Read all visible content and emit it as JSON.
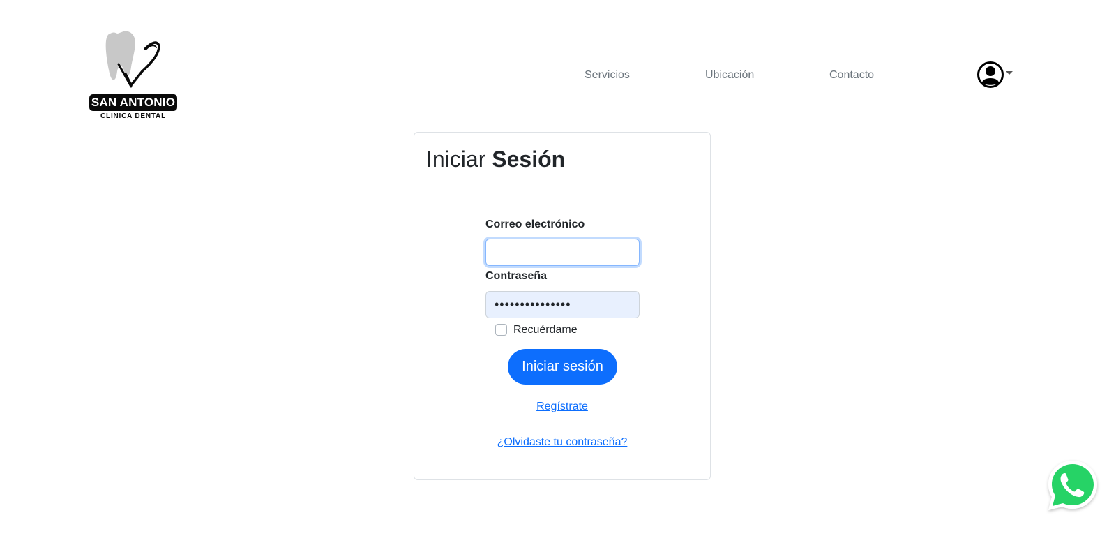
{
  "logo": {
    "line1": "SAN ANTONIO",
    "line2": "CLINICA DENTAL"
  },
  "nav": {
    "items": [
      {
        "label": "Servicios"
      },
      {
        "label": "Ubicación"
      },
      {
        "label": "Contacto"
      }
    ],
    "user_icon": "user-circle-icon"
  },
  "login": {
    "title_regular": "Iniciar",
    "title_bold": "Sesión",
    "email_label": "Correo electrónico",
    "email_value": "",
    "password_label": "Contraseña",
    "password_value": "•••••••••••••••",
    "remember_label": "Recuérdame",
    "remember_checked": false,
    "submit_label": "Iniciar sesión",
    "register_link": "Regístrate",
    "forgot_link": "¿Olvidaste tu contraseña?"
  },
  "floating": {
    "icon": "whatsapp-icon"
  },
  "colors": {
    "primary": "#0d6efd",
    "nav_text": "#6c757d",
    "autofill_bg": "#e8f0fe",
    "whatsapp": "#25d366"
  }
}
